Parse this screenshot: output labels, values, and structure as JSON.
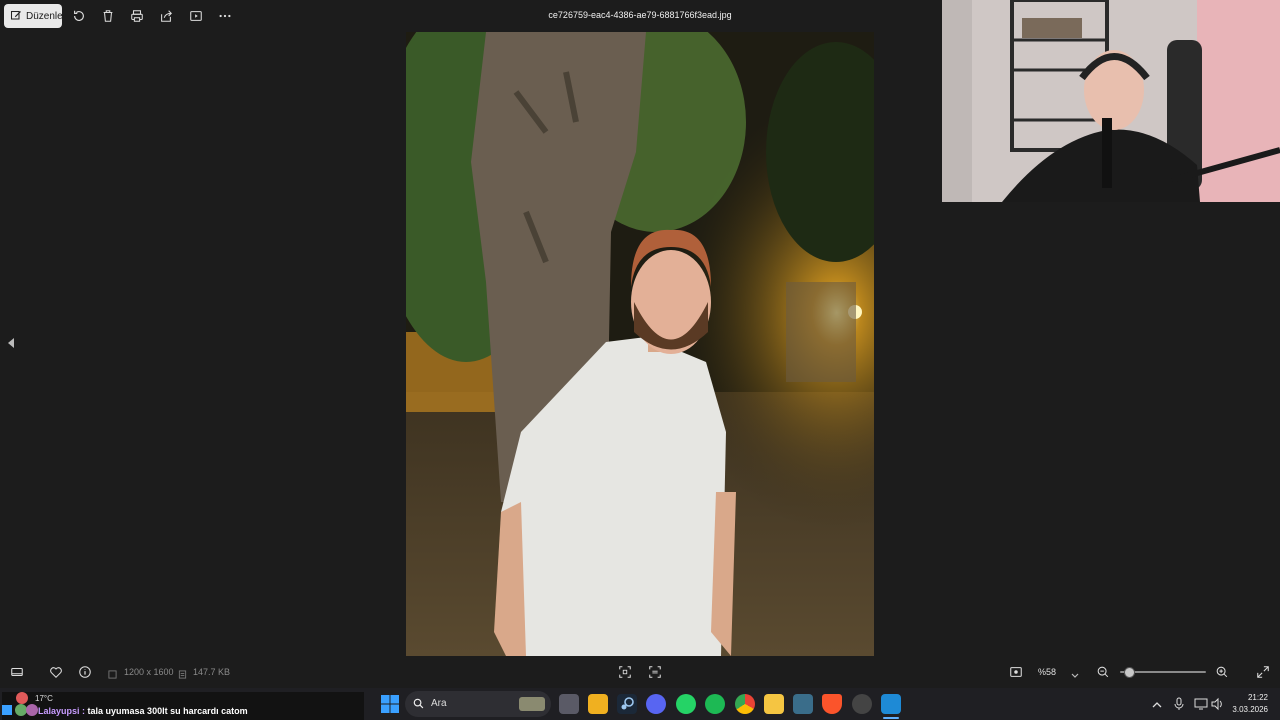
{
  "toolbar": {
    "edit_label": "Düzenle",
    "filename": "ce726759-eac4-4386-ae79-6881766f3ead.jpg"
  },
  "statusbar": {
    "dimensions": "1200 x 1600",
    "file_size": "147.7 KB",
    "zoom": "%58",
    "zoom_level": 0.1
  },
  "ticker": {
    "weather": "17°C",
    "user": "Lalayupsi :",
    "message": "tala uyumasa 300lt su harcardı catom"
  },
  "taskbar": {
    "search_placeholder": "Ara",
    "time": "21:22",
    "date": "3.03.2026"
  },
  "colors": {
    "background": "#1c1c1c",
    "accent": "#0a84ff",
    "taskbar": "#1f1f23"
  }
}
